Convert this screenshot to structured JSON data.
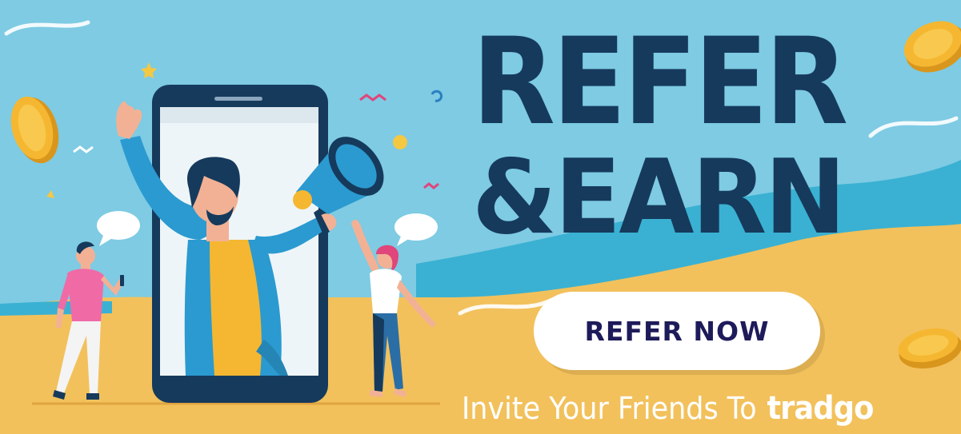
{
  "banner": {
    "headline_line1": "REFER",
    "headline_line2": "&EARN",
    "cta_label": "REFER NOW",
    "tagline_text": "Invite Your Friends To",
    "brand_name": "tradgo"
  },
  "colors": {
    "sky": "#7ecbe3",
    "sand": "#f2c15c",
    "wave": "#3ab1d2",
    "headline": "#163a5c",
    "cta_text": "#1e1b5a",
    "coin": "#f5b731"
  },
  "icons": [
    "gold-coin-icon",
    "megaphone-icon",
    "speech-bubble-icon",
    "smartphone-icon"
  ]
}
